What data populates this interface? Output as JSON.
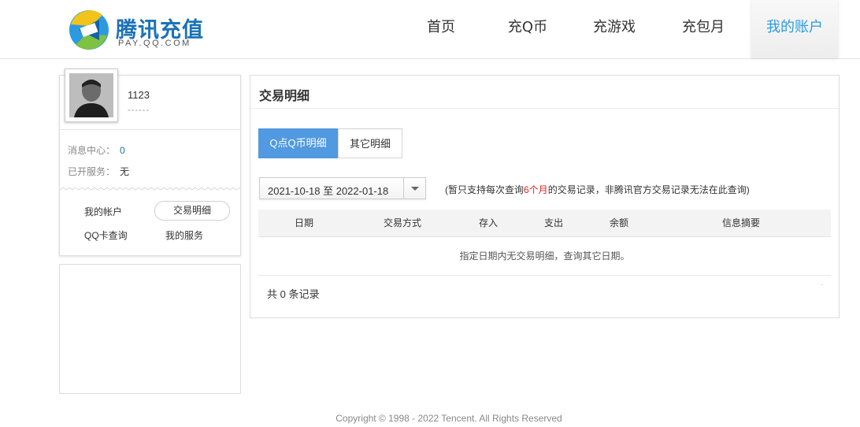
{
  "header": {
    "logo_text": "腾讯充值",
    "logo_sub": "PAY.QQ.COM",
    "nav": [
      {
        "label": "首页",
        "active": false
      },
      {
        "label": "充Q币",
        "active": false
      },
      {
        "label": "充游戏",
        "active": false
      },
      {
        "label": "充包月",
        "active": false
      },
      {
        "label": "我的账户",
        "active": true
      }
    ]
  },
  "sidebar": {
    "username": "1123",
    "user_sub": "------",
    "messages_label": "消息中心：",
    "messages_count": "0",
    "services_label": "已开服务：",
    "services_value": "无",
    "links": {
      "my_account": "我的帐户",
      "transactions": "交易明细",
      "qq_card": "QQ卡查询",
      "my_services": "我的服务"
    }
  },
  "main": {
    "title": "交易明细",
    "tabs": [
      {
        "label": "Q点Q币明细",
        "active": true
      },
      {
        "label": "其它明细",
        "active": false
      }
    ],
    "date_range": "2021-10-18 至 2022-01-18",
    "notice_before": "(暂只支持每次查询",
    "notice_highlight": "6个月",
    "notice_after": "的交易记录，非腾讯官方交易记录无法在此查询)",
    "table": {
      "columns": [
        "日期",
        "交易方式",
        "存入",
        "支出",
        "余额",
        "信息摘要"
      ],
      "empty_message": "指定日期内无交易明细，查询其它日期。"
    },
    "total": "共 0 条记录"
  },
  "footer": {
    "copyright": "Copyright © 1998 - 2022 Tencent. All Rights Reserved"
  },
  "colors": {
    "brand_blue": "#1b72b8",
    "active_nav": "#2b9be3",
    "tab_active_bg": "#5199e0",
    "highlight_red": "#d8261f"
  }
}
